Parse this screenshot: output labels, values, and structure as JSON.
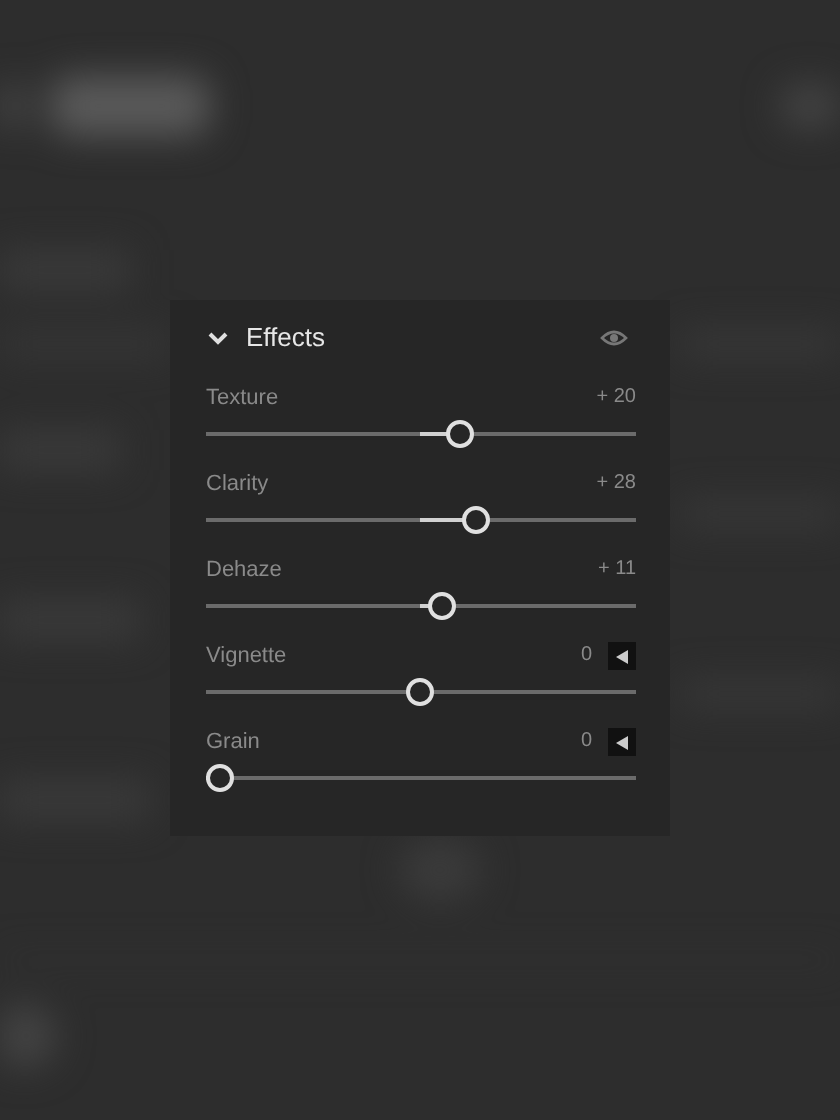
{
  "panel": {
    "title": "Effects",
    "expanded": true
  },
  "sliders": [
    {
      "kind": "bipolar",
      "label": "Texture",
      "reading": "+ 20",
      "level": 0.6,
      "expandable": false
    },
    {
      "kind": "bipolar",
      "label": "Clarity",
      "reading": "+ 28",
      "level": 0.64,
      "expandable": false
    },
    {
      "kind": "bipolar",
      "label": "Dehaze",
      "reading": "+ 11",
      "level": 0.555,
      "expandable": false
    },
    {
      "kind": "bipolar",
      "label": "Vignette",
      "reading": "0",
      "level": 0.5,
      "expandable": true
    },
    {
      "kind": "unipolar",
      "label": "Grain",
      "reading": "0",
      "level": 0,
      "expandable": true
    }
  ]
}
